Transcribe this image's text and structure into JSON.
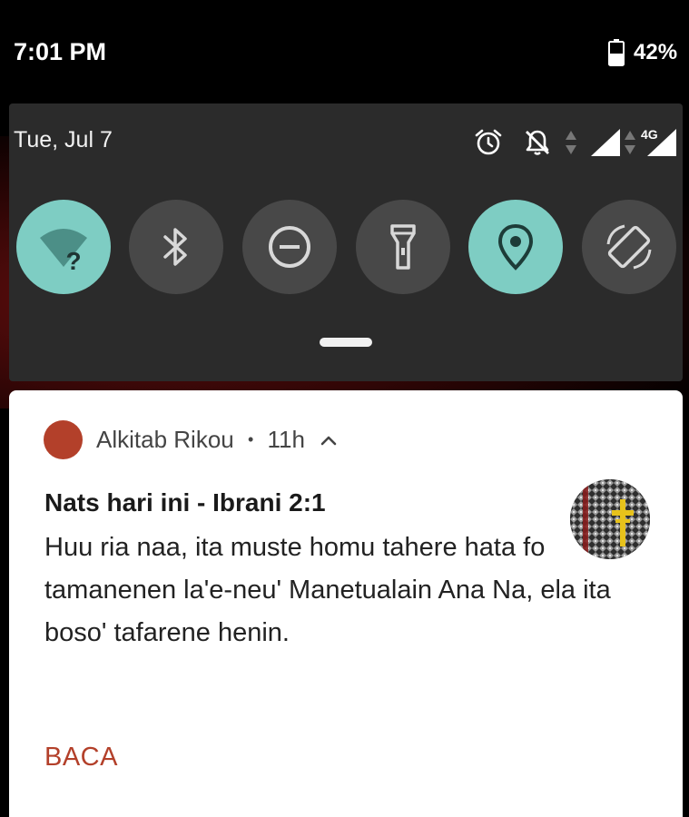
{
  "status_bar": {
    "time": "7:01 PM",
    "battery_percent": "42%",
    "battery_level": 0.42
  },
  "quick_settings": {
    "date": "Tue, Jul 7",
    "network_type": "4G",
    "accent_color": "#7ecdc3",
    "tiles": [
      {
        "name": "wifi",
        "icon": "wifi-question-icon",
        "active": true
      },
      {
        "name": "bluetooth",
        "icon": "bluetooth-icon",
        "active": false
      },
      {
        "name": "do-not-disturb",
        "icon": "do-not-disturb-icon",
        "active": false
      },
      {
        "name": "flashlight",
        "icon": "flashlight-icon",
        "active": false
      },
      {
        "name": "location",
        "icon": "location-pin-icon",
        "active": true
      },
      {
        "name": "auto-rotate",
        "icon": "auto-rotate-icon",
        "active": false
      }
    ]
  },
  "notification": {
    "app_name": "Alkitab Rikou",
    "separator": "•",
    "time_ago": "11h",
    "title": "Nats hari ini - Ibrani 2:1",
    "body": "Huu ria naa, ita muste homu tahere hata fo tamanenen la'e-neu' Manetualain Ana Na, ela ita boso' tafarene henin.",
    "action_label": "BACA",
    "accent_color": "#b3402a"
  }
}
